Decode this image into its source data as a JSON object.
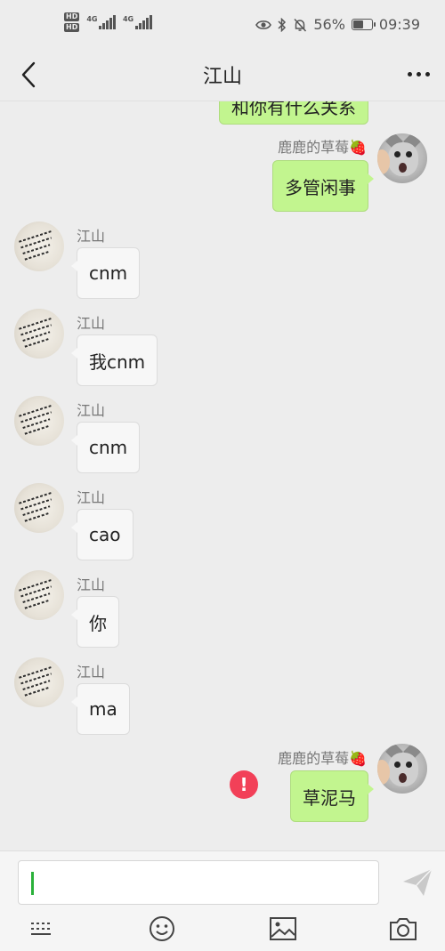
{
  "status_bar": {
    "hd1": "HD",
    "hd2": "HD",
    "net1": "4G",
    "net2": "4G",
    "battery_text": "56%",
    "battery_level": 0.56,
    "time": "09:39"
  },
  "header": {
    "title": "江山"
  },
  "messages": {
    "m0": {
      "text": "和你有什么关系"
    },
    "m1": {
      "sender": "鹿鹿的草莓🍓",
      "text": "多管闲事"
    },
    "m2": {
      "sender": "江山",
      "text": "cnm"
    },
    "m3": {
      "sender": "江山",
      "text": "我cnm"
    },
    "m4": {
      "sender": "江山",
      "text": "cnm"
    },
    "m5": {
      "sender": "江山",
      "text": "cao"
    },
    "m6": {
      "sender": "江山",
      "text": "你"
    },
    "m7": {
      "sender": "江山",
      "text": "ma"
    },
    "m8": {
      "sender": "鹿鹿的草莓🍓",
      "text": "草泥马",
      "failed": true
    }
  },
  "composer": {
    "value": ""
  },
  "icons": {
    "back": "chevron-left-icon",
    "more": "more-dots-icon",
    "failed": "exclamation-icon",
    "send": "send-icon",
    "keyboard": "keyboard-icon",
    "emoji": "emoji-icon",
    "image": "image-icon",
    "camera": "camera-icon"
  },
  "colors": {
    "my_bubble": "#c2f58f",
    "their_bubble": "#f7f7f7",
    "error": "#f24058",
    "caret": "#2ab13a"
  }
}
